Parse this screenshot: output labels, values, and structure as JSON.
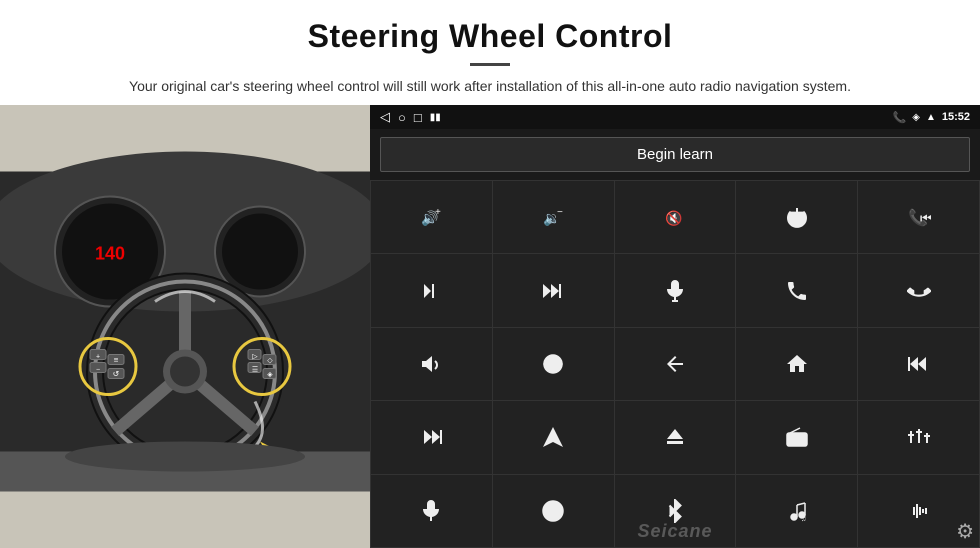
{
  "header": {
    "title": "Steering Wheel Control",
    "subtitle": "Your original car's steering wheel control will still work after installation of this all-in-one auto radio navigation system."
  },
  "status_bar": {
    "back_icon": "◁",
    "home_icon": "○",
    "recent_icon": "□",
    "battery_icon": "▮▮",
    "phone_icon": "📞",
    "location_icon": "◈",
    "wifi_icon": "▲",
    "time": "15:52"
  },
  "begin_learn": {
    "label": "Begin learn"
  },
  "controls": [
    {
      "icon": "vol_up",
      "unicode": "🔊+",
      "row": 1,
      "col": 1
    },
    {
      "icon": "vol_down",
      "unicode": "🔉−",
      "row": 1,
      "col": 2
    },
    {
      "icon": "mute",
      "unicode": "🔇",
      "row": 1,
      "col": 3
    },
    {
      "icon": "power",
      "unicode": "⏻",
      "row": 1,
      "col": 4
    },
    {
      "icon": "prev_track",
      "unicode": "⏮",
      "row": 1,
      "col": 5
    },
    {
      "icon": "next",
      "unicode": "⏭",
      "row": 2,
      "col": 1
    },
    {
      "icon": "forward",
      "unicode": "⏩",
      "row": 2,
      "col": 2
    },
    {
      "icon": "mic",
      "unicode": "🎤",
      "row": 2,
      "col": 3
    },
    {
      "icon": "phone",
      "unicode": "📞",
      "row": 2,
      "col": 4
    },
    {
      "icon": "hangup",
      "unicode": "↩",
      "row": 2,
      "col": 5
    },
    {
      "icon": "horn",
      "unicode": "📢",
      "row": 3,
      "col": 1
    },
    {
      "icon": "360",
      "unicode": "360°",
      "row": 3,
      "col": 2
    },
    {
      "icon": "back",
      "unicode": "↩",
      "row": 3,
      "col": 3
    },
    {
      "icon": "home",
      "unicode": "⌂",
      "row": 3,
      "col": 4
    },
    {
      "icon": "rewind",
      "unicode": "⏮",
      "row": 3,
      "col": 5
    },
    {
      "icon": "skip_fwd",
      "unicode": "⏭",
      "row": 4,
      "col": 1
    },
    {
      "icon": "nav",
      "unicode": "▲",
      "row": 4,
      "col": 2
    },
    {
      "icon": "eject",
      "unicode": "⏏",
      "row": 4,
      "col": 3
    },
    {
      "icon": "radio",
      "unicode": "📻",
      "row": 4,
      "col": 4
    },
    {
      "icon": "equalizer",
      "unicode": "⟺",
      "row": 4,
      "col": 5
    },
    {
      "icon": "mic2",
      "unicode": "🎙",
      "row": 5,
      "col": 1
    },
    {
      "icon": "settings2",
      "unicode": "⚙",
      "row": 5,
      "col": 2
    },
    {
      "icon": "bluetooth",
      "unicode": "Ⓑ",
      "row": 5,
      "col": 3
    },
    {
      "icon": "music",
      "unicode": "♫",
      "row": 5,
      "col": 4
    },
    {
      "icon": "waveform",
      "unicode": "▌▌▌",
      "row": 5,
      "col": 5
    }
  ],
  "watermark": {
    "text": "Seicane"
  },
  "gear": {
    "icon": "⚙"
  }
}
